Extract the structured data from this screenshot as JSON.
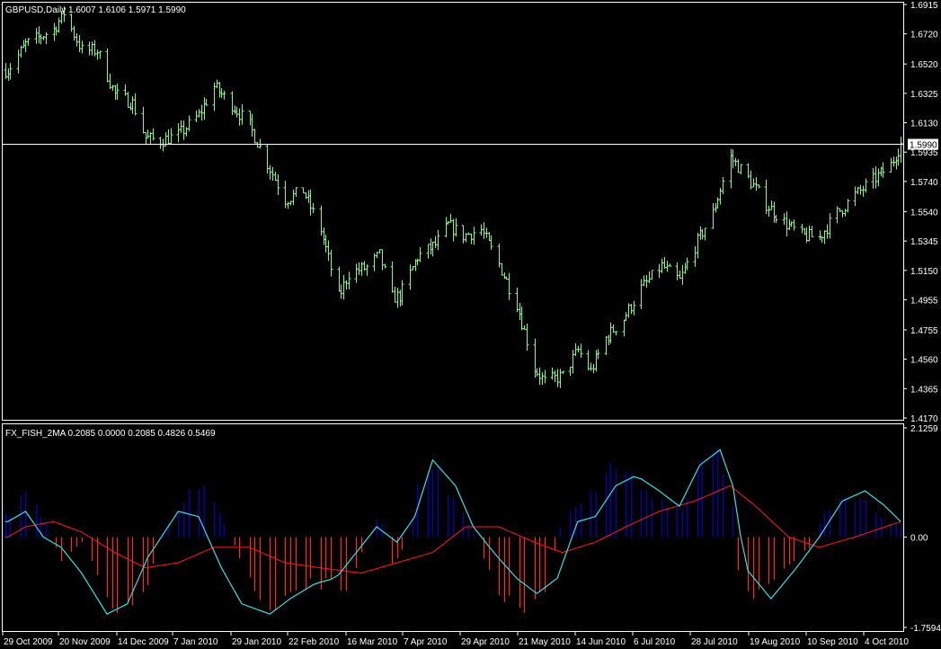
{
  "main_chart": {
    "header": "GBPUSD,Daily  1.6007 1.6106 1.5971 1.5990",
    "current_price": 1.599,
    "current_price_label": "1.5990",
    "y_ticks": [
      "1.6915",
      "1.6720",
      "1.6520",
      "1.6325",
      "1.6130",
      "1.5935",
      "1.5740",
      "1.5540",
      "1.5345",
      "1.5150",
      "1.4955",
      "1.4755",
      "1.4560",
      "1.4365",
      "1.4170"
    ]
  },
  "indicator": {
    "header": "FX_FISH_2MA 0.2085 0.0000 0.2085 0.4826 0.5469",
    "y_ticks": [
      "2.1259",
      "0.00",
      "-1.7594"
    ]
  },
  "x_ticks": [
    "29 Oct 2009",
    "20 Nov 2009",
    "14 Dec 2009",
    "7 Jan 2010",
    "29 Jan 2010",
    "22 Feb 2010",
    "16 Mar 2010",
    "7 Apr 2010",
    "29 Apr 2010",
    "21 May 2010",
    "14 Jun 2010",
    "6 Jul 2010",
    "28 Jul 2010",
    "19 Aug 2010",
    "10 Sep 2010",
    "4 Oct 2010"
  ],
  "colors": {
    "background": "#000000",
    "candles": "#7cfc7c",
    "histogram_positive": "#0000cd",
    "histogram_negative": "#ff2a1a",
    "fast_line": "#35e0e6",
    "slow_line": "#ff1a1a",
    "price_line": "#ffffff",
    "frame": "#ffffff"
  },
  "chart_data": [
    {
      "type": "candlestick",
      "title": "GBPUSD,Daily",
      "ohlc_label": "1.6007 1.6106 1.5971 1.5990",
      "x_range": [
        "2009-10-29",
        "2010-10-08"
      ],
      "ylim": [
        1.417,
        1.6915
      ],
      "close_path": [
        [
          "2009-10-22",
          1.648
        ],
        [
          "2009-10-29",
          1.665
        ],
        [
          "2009-11-09",
          1.675
        ],
        [
          "2009-11-13",
          1.686
        ],
        [
          "2009-11-20",
          1.661
        ],
        [
          "2009-11-26",
          1.661
        ],
        [
          "2009-12-03",
          1.632
        ],
        [
          "2009-12-10",
          1.626
        ],
        [
          "2009-12-15",
          1.603
        ],
        [
          "2009-12-21",
          1.601
        ],
        [
          "2009-12-28",
          1.605
        ],
        [
          "2010-01-05",
          1.618
        ],
        [
          "2010-01-11",
          1.637
        ],
        [
          "2010-01-18",
          1.625
        ],
        [
          "2010-01-25",
          1.611
        ],
        [
          "2010-02-01",
          1.586
        ],
        [
          "2010-02-08",
          1.562
        ],
        [
          "2010-02-15",
          1.568
        ],
        [
          "2010-02-22",
          1.542
        ],
        [
          "2010-03-01",
          1.497
        ],
        [
          "2010-03-05",
          1.513
        ],
        [
          "2010-03-12",
          1.517
        ],
        [
          "2010-03-17",
          1.525
        ],
        [
          "2010-03-22",
          1.497
        ],
        [
          "2010-03-25",
          1.498
        ],
        [
          "2010-04-01",
          1.524
        ],
        [
          "2010-04-08",
          1.532
        ],
        [
          "2010-04-13",
          1.545
        ],
        [
          "2010-04-19",
          1.538
        ],
        [
          "2010-04-26",
          1.542
        ],
        [
          "2010-05-03",
          1.519
        ],
        [
          "2010-05-10",
          1.493
        ],
        [
          "2010-05-17",
          1.45
        ],
        [
          "2010-05-21",
          1.441
        ],
        [
          "2010-05-28",
          1.445
        ],
        [
          "2010-06-03",
          1.462
        ],
        [
          "2010-06-08",
          1.448
        ],
        [
          "2010-06-14",
          1.47
        ],
        [
          "2010-06-21",
          1.483
        ],
        [
          "2010-06-28",
          1.503
        ],
        [
          "2010-07-06",
          1.518
        ],
        [
          "2010-07-13",
          1.508
        ],
        [
          "2010-07-19",
          1.531
        ],
        [
          "2010-07-26",
          1.553
        ],
        [
          "2010-08-02",
          1.59
        ],
        [
          "2010-08-09",
          1.576
        ],
        [
          "2010-08-16",
          1.559
        ],
        [
          "2010-08-23",
          1.547
        ],
        [
          "2010-08-30",
          1.538
        ],
        [
          "2010-09-06",
          1.537
        ],
        [
          "2010-09-13",
          1.553
        ],
        [
          "2010-09-20",
          1.565
        ],
        [
          "2010-09-27",
          1.575
        ],
        [
          "2010-10-04",
          1.585
        ],
        [
          "2010-10-08",
          1.599
        ]
      ]
    },
    {
      "type": "histogram_with_lines",
      "title": "FX_FISH_2MA",
      "values_label": "0.2085 0.0000 0.2085 0.4826 0.5469",
      "ylim": [
        -1.7594,
        2.1259
      ],
      "histogram_path": [
        [
          "2009-10-22",
          0.4
        ],
        [
          "2009-10-29",
          0.9
        ],
        [
          "2009-11-06",
          0.3
        ],
        [
          "2009-11-12",
          -0.5
        ],
        [
          "2009-11-20",
          -0.1
        ],
        [
          "2009-11-30",
          -1.2
        ],
        [
          "2009-12-08",
          -1.5
        ],
        [
          "2009-12-16",
          -0.9
        ],
        [
          "2009-12-23",
          0.2
        ],
        [
          "2010-01-04",
          1.1
        ],
        [
          "2010-01-14",
          0.4
        ],
        [
          "2010-01-22",
          -0.5
        ],
        [
          "2010-01-29",
          -1.3
        ],
        [
          "2010-02-05",
          -1.6
        ],
        [
          "2010-02-12",
          -1.0
        ],
        [
          "2010-02-22",
          -0.9
        ],
        [
          "2010-03-05",
          -1.0
        ],
        [
          "2010-03-12",
          0.0
        ],
        [
          "2010-03-17",
          0.5
        ],
        [
          "2010-03-22",
          -0.6
        ],
        [
          "2010-03-29",
          0.0
        ],
        [
          "2010-04-02",
          1.6
        ],
        [
          "2010-04-09",
          1.2
        ],
        [
          "2010-04-20",
          0.4
        ],
        [
          "2010-04-26",
          -0.3
        ],
        [
          "2010-05-05",
          -1.2
        ],
        [
          "2010-05-13",
          -1.5
        ],
        [
          "2010-05-21",
          -1.1
        ],
        [
          "2010-05-28",
          0.4
        ],
        [
          "2010-06-04",
          0.6
        ],
        [
          "2010-06-14",
          1.3
        ],
        [
          "2010-06-22",
          1.2
        ],
        [
          "2010-07-01",
          0.8
        ],
        [
          "2010-07-09",
          0.7
        ],
        [
          "2010-07-15",
          0.6
        ],
        [
          "2010-07-21",
          1.5
        ],
        [
          "2010-07-27",
          1.9
        ],
        [
          "2010-08-03",
          0.6
        ],
        [
          "2010-08-06",
          -1.4
        ],
        [
          "2010-08-13",
          -1.0
        ],
        [
          "2010-08-25",
          -0.5
        ],
        [
          "2010-09-02",
          -0.2
        ],
        [
          "2010-09-08",
          0.5
        ],
        [
          "2010-09-15",
          0.9
        ],
        [
          "2010-09-24",
          0.7
        ],
        [
          "2010-10-01",
          0.4
        ],
        [
          "2010-10-08",
          0.2
        ]
      ],
      "fast_line_path": [
        [
          "2009-10-22",
          0.3
        ],
        [
          "2009-10-29",
          0.5
        ],
        [
          "2009-11-05",
          0.0
        ],
        [
          "2009-11-12",
          -0.2
        ],
        [
          "2009-11-20",
          -0.7
        ],
        [
          "2009-11-30",
          -1.5
        ],
        [
          "2009-12-08",
          -1.3
        ],
        [
          "2009-12-16",
          -0.4
        ],
        [
          "2009-12-28",
          0.5
        ],
        [
          "2010-01-05",
          0.4
        ],
        [
          "2010-01-14",
          -0.6
        ],
        [
          "2010-01-22",
          -1.3
        ],
        [
          "2010-02-02",
          -1.5
        ],
        [
          "2010-02-10",
          -1.2
        ],
        [
          "2010-02-20",
          -0.9
        ],
        [
          "2010-02-28",
          -0.8
        ],
        [
          "2010-03-08",
          -0.3
        ],
        [
          "2010-03-16",
          0.2
        ],
        [
          "2010-03-24",
          -0.1
        ],
        [
          "2010-03-31",
          0.4
        ],
        [
          "2010-04-07",
          1.5
        ],
        [
          "2010-04-16",
          1.0
        ],
        [
          "2010-04-23",
          0.2
        ],
        [
          "2010-05-01",
          -0.3
        ],
        [
          "2010-05-10",
          -0.8
        ],
        [
          "2010-05-18",
          -1.1
        ],
        [
          "2010-05-26",
          -0.8
        ],
        [
          "2010-06-03",
          0.3
        ],
        [
          "2010-06-10",
          0.4
        ],
        [
          "2010-06-18",
          1.0
        ],
        [
          "2010-06-26",
          1.2
        ],
        [
          "2010-07-05",
          0.9
        ],
        [
          "2010-07-13",
          0.6
        ],
        [
          "2010-07-21",
          1.4
        ],
        [
          "2010-07-29",
          1.7
        ],
        [
          "2010-08-03",
          1.0
        ],
        [
          "2010-08-08",
          -0.6
        ],
        [
          "2010-08-18",
          -1.2
        ],
        [
          "2010-08-28",
          -0.6
        ],
        [
          "2010-09-06",
          0.0
        ],
        [
          "2010-09-15",
          0.7
        ],
        [
          "2010-09-24",
          0.9
        ],
        [
          "2010-10-02",
          0.6
        ],
        [
          "2010-10-08",
          0.3
        ]
      ],
      "slow_line_path": [
        [
          "2009-10-22",
          0.0
        ],
        [
          "2009-10-29",
          0.2
        ],
        [
          "2009-11-09",
          0.3
        ],
        [
          "2009-11-20",
          0.1
        ],
        [
          "2009-12-03",
          -0.3
        ],
        [
          "2009-12-15",
          -0.6
        ],
        [
          "2009-12-28",
          -0.5
        ],
        [
          "2010-01-11",
          -0.2
        ],
        [
          "2010-01-25",
          -0.2
        ],
        [
          "2010-02-08",
          -0.5
        ],
        [
          "2010-02-22",
          -0.6
        ],
        [
          "2010-03-10",
          -0.7
        ],
        [
          "2010-03-24",
          -0.5
        ],
        [
          "2010-04-07",
          -0.3
        ],
        [
          "2010-04-20",
          0.2
        ],
        [
          "2010-05-03",
          0.2
        ],
        [
          "2010-05-17",
          -0.1
        ],
        [
          "2010-05-28",
          -0.3
        ],
        [
          "2010-06-10",
          -0.1
        ],
        [
          "2010-06-22",
          0.2
        ],
        [
          "2010-07-05",
          0.5
        ],
        [
          "2010-07-19",
          0.7
        ],
        [
          "2010-08-02",
          1.0
        ],
        [
          "2010-08-12",
          0.6
        ],
        [
          "2010-08-25",
          0.0
        ],
        [
          "2010-09-06",
          -0.2
        ],
        [
          "2010-09-20",
          0.0
        ],
        [
          "2010-10-08",
          0.3
        ]
      ]
    }
  ]
}
